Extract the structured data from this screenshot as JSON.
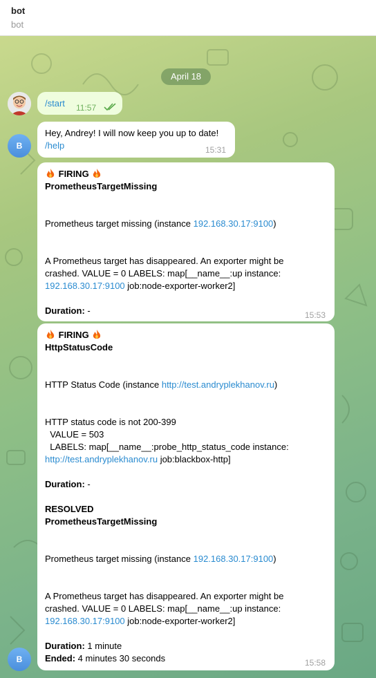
{
  "header": {
    "title": "bot",
    "subtitle": "bot"
  },
  "date_chip": "April 18",
  "messages": [
    {
      "sender": "user",
      "text": "/start",
      "time": "11:57",
      "read": true
    },
    {
      "sender": "bot",
      "line1": "Hey, Andrey! I will now keep you up to date!",
      "line2": "/help",
      "time": "15:31",
      "avatar_letter": "B"
    },
    {
      "sender": "bot",
      "time": "15:53",
      "status": "FIRING",
      "alert_name": "PrometheusTargetMissing",
      "summary_prefix": "Prometheus target missing (instance ",
      "summary_link": "192.168.30.17:9100",
      "summary_suffix": ")",
      "desc_line1": "A Prometheus target has disappeared. An exporter might be",
      "desc_line2": "crashed. VALUE = 0  LABELS: map[__name__:up instance:",
      "desc_link": "192.168.30.17:9100",
      "desc_line3_suffix": " job:node-exporter-worker2]",
      "duration_label": "Duration:",
      "duration_value": " -"
    },
    {
      "sender": "bot",
      "time": "15:58",
      "avatar_letter": "B",
      "status": "FIRING",
      "alert_name": "HttpStatusCode",
      "summary_prefix": "HTTP Status Code (instance ",
      "summary_link": "http://test.andryplekhanov.ru",
      "summary_suffix": ")",
      "desc_line1": "HTTP status code is not 200-399",
      "desc_line2": "  VALUE = 503",
      "desc_line3": "  LABELS: map[__name__:probe_http_status_code instance:",
      "desc_link": "http://test.andryplekhanov.ru",
      "desc_line4_suffix": " job:blackbox-http]",
      "duration_label": "Duration:",
      "duration_value": " -",
      "resolved_status": "RESOLVED",
      "resolved_name": "PrometheusTargetMissing",
      "resolved_summary_prefix": "Prometheus target missing (instance ",
      "resolved_summary_link": "192.168.30.17:9100",
      "resolved_summary_suffix": ")",
      "resolved_desc_line1": "A Prometheus target has disappeared. An exporter might be",
      "resolved_desc_line2": "crashed. VALUE = 0  LABELS: map[__name__:up instance:",
      "resolved_desc_link": "192.168.30.17:9100",
      "resolved_desc_line3_suffix": " job:node-exporter-worker2]",
      "resolved_duration_label": "Duration:",
      "resolved_duration_value": " 1 minute",
      "ended_label": "Ended:",
      "ended_value": " 4 minutes 30 seconds"
    }
  ],
  "icons": {
    "fire": "fire-icon",
    "double-check": "double-check-icon"
  },
  "colors": {
    "link": "#2a8bd0",
    "out_bubble": "#effdde",
    "in_bubble": "#ffffff",
    "bot_avatar": "#4a8fdc"
  }
}
